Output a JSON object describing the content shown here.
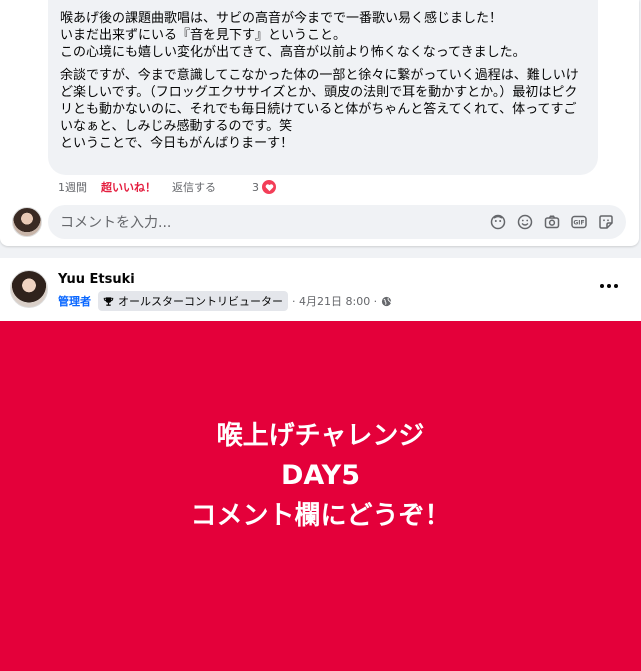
{
  "comment": {
    "paragraph1": "喉あげ後の課題曲歌唱は、サビの高音が今までで一番歌い易く感じました！\nいまだ出来ずにいる『音を見下す』ということ。\nこの心境にも嬉しい変化が出てきて、高音が以前より怖くなくなってきました。",
    "paragraph2": "余談ですが、今まで意識してこなかった体の一部と徐々に繋がっていく過程は、難しいけど楽しいです。（フロッグエクササイズとか、頭皮の法則で耳を動かすとか。）最初はピクリとも動かないのに、それでも毎日続けていると体がちゃんと答えてくれて、体ってすごいなぁと、しみじみ感動するのです。笑\nということで、今日もがんばりまーす！",
    "time": "1週間",
    "like_label": "超いいね！",
    "reply_label": "返信する",
    "reaction_count": "3",
    "reaction_color": "#f33e58"
  },
  "composer": {
    "placeholder": "コメントを入力...",
    "tools": [
      "avatar-sticker-icon",
      "emoji-icon",
      "camera-icon",
      "gif-icon",
      "sticker-icon"
    ]
  },
  "post": {
    "author": "Yuu Etsuki",
    "role": "管理者",
    "badge": "オールスターコントリビューター",
    "date": "· 4月21日 8:00 ·",
    "banner_color": "#e4003a",
    "banner_lines": [
      "喉上げチャレンジ",
      "DAY5",
      "コメント欄にどうぞ！"
    ]
  }
}
